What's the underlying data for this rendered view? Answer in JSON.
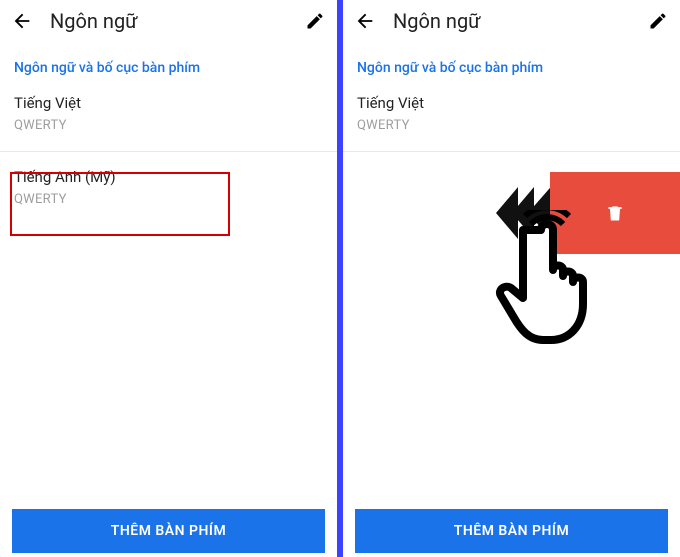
{
  "left": {
    "header": {
      "title": "Ngôn ngữ"
    },
    "section_label": "Ngôn ngữ và bố cục bàn phím",
    "lang1": {
      "name": "Tiếng Việt",
      "layout": "QWERTY"
    },
    "lang2": {
      "name": "Tiếng Anh (Mỹ)",
      "layout": "QWERTY"
    },
    "add_button": "THÊM BÀN PHÍM"
  },
  "right": {
    "header": {
      "title": "Ngôn ngữ"
    },
    "section_label": "Ngôn ngữ và bố cục bàn phím",
    "lang1": {
      "name": "Tiếng Việt",
      "layout": "QWERTY"
    },
    "add_button": "THÊM BÀN PHÍM"
  }
}
